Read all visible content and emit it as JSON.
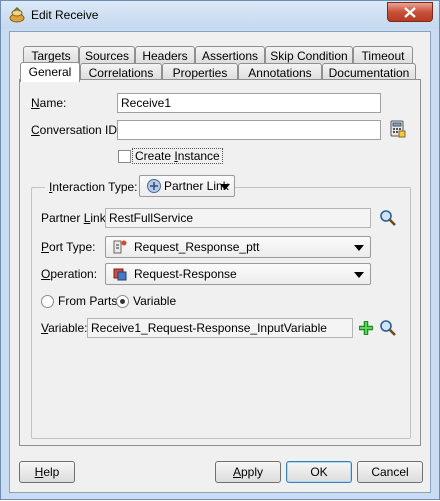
{
  "window": {
    "title": "Edit Receive"
  },
  "tabs_row1": [
    {
      "label": "Targets"
    },
    {
      "label": "Sources"
    },
    {
      "label": "Headers"
    },
    {
      "label": "Assertions"
    },
    {
      "label": "Skip Condition"
    },
    {
      "label": "Timeout"
    }
  ],
  "tabs_row2": [
    {
      "label": "General",
      "active": true
    },
    {
      "label": "Correlations"
    },
    {
      "label": "Properties"
    },
    {
      "label": "Annotations"
    },
    {
      "label": "Documentation"
    }
  ],
  "general": {
    "name_label_first": "N",
    "name_label_rest": "ame:",
    "name_value": "Receive1",
    "conv_label_first": "C",
    "conv_label_rest": "onversation ID:",
    "conv_value": "",
    "create_instance_first": "Create ",
    "create_instance_u": "I",
    "create_instance_rest": "nstance",
    "create_instance_checked": false,
    "interaction_label_first": "I",
    "interaction_label_rest": "nteraction Type:",
    "interaction_value": "Partner Link",
    "partner_link_label_first": "Partner ",
    "partner_link_label_u": "L",
    "partner_link_label_rest": "ink:",
    "partner_link_value": "RestFullService",
    "port_type_label_first": "P",
    "port_type_label_rest": "ort Type:",
    "port_type_value": "Request_Response_ptt",
    "operation_label_first": "O",
    "operation_label_rest": "peration:",
    "operation_value": "Request-Response",
    "from_parts_label": "From Parts",
    "variable_radio_label": "Variable",
    "selected_mode": "Variable",
    "variable_label_first": "V",
    "variable_label_rest": "ariable:",
    "variable_value": "Receive1_Request-Response_InputVariable"
  },
  "footer": {
    "help_u": "H",
    "help_rest": "elp",
    "apply_u": "A",
    "apply_rest": "pply",
    "ok": "OK",
    "cancel": "Cancel"
  },
  "icons": {
    "app": "bpel-receive-icon",
    "close": "close-icon",
    "expression": "expression-builder-icon",
    "interaction": "partner-link-icon",
    "search": "search-icon",
    "port_type": "port-type-icon",
    "operation": "operation-icon",
    "add": "add-icon"
  },
  "colors": {
    "accent": "#3c7fb1",
    "close": "#c9503a"
  }
}
